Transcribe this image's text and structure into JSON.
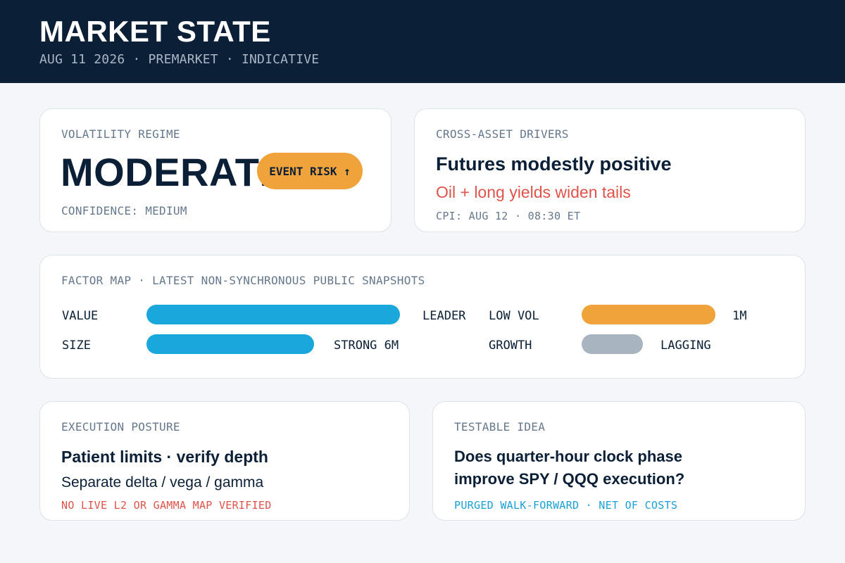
{
  "header": {
    "title": "MARKET STATE",
    "subtitle": "AUG 11 2026 · PREMARKET · INDICATIVE"
  },
  "volatility": {
    "label": "VOLATILITY REGIME",
    "value": "MODERATE",
    "badge": "EVENT RISK ↑",
    "confidence": "CONFIDENCE: MEDIUM"
  },
  "cross_asset": {
    "label": "CROSS-ASSET DRIVERS",
    "headline": "Futures modestly positive",
    "risk": "Oil + long yields widen tails",
    "event": "CPI: AUG 12 · 08:30 ET"
  },
  "factor_map": {
    "label": "FACTOR MAP · LATEST NON-SYNCHRONOUS PUBLIC SNAPSHOTS",
    "factors": [
      {
        "name": "VALUE",
        "status": "LEADER",
        "strength": 1.0,
        "color": "#1aa7db"
      },
      {
        "name": "SIZE",
        "status": "STRONG 6M",
        "strength": 0.66,
        "color": "#1aa7db"
      },
      {
        "name": "LOW VOL",
        "status": "1M",
        "strength": 1.0,
        "color": "#f0a33a"
      },
      {
        "name": "GROWTH",
        "status": "LAGGING",
        "strength": 0.46,
        "color": "#a9b4c1"
      }
    ]
  },
  "execution": {
    "label": "EXECUTION POSTURE",
    "headline": "Patient limits · verify depth",
    "detail": "Separate delta / vega / gamma",
    "warning": "NO LIVE L2 OR GAMMA MAP VERIFIED"
  },
  "idea": {
    "label": "TESTABLE IDEA",
    "line1": "Does quarter-hour clock phase",
    "line2": "improve SPY / QQQ execution?",
    "method": "PURGED WALK-FORWARD · NET OF COSTS"
  }
}
